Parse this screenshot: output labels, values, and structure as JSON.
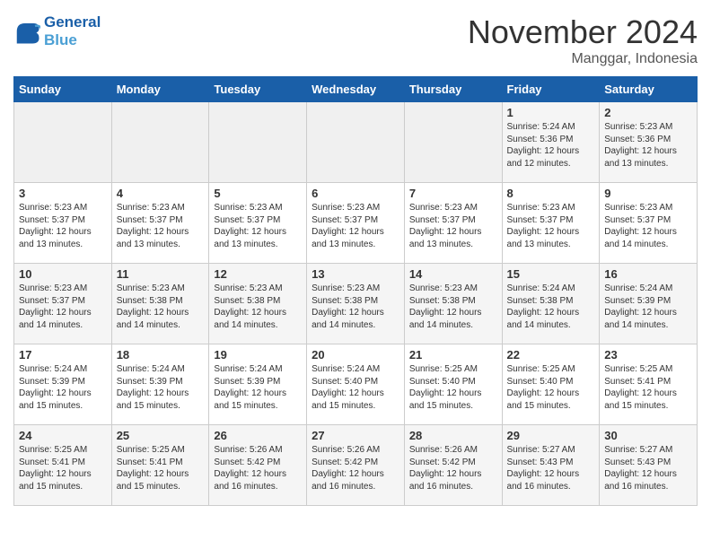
{
  "logo": {
    "text_general": "General",
    "text_blue": "Blue"
  },
  "header": {
    "month": "November 2024",
    "location": "Manggar, Indonesia"
  },
  "days_of_week": [
    "Sunday",
    "Monday",
    "Tuesday",
    "Wednesday",
    "Thursday",
    "Friday",
    "Saturday"
  ],
  "weeks": [
    [
      {
        "day": "",
        "info": ""
      },
      {
        "day": "",
        "info": ""
      },
      {
        "day": "",
        "info": ""
      },
      {
        "day": "",
        "info": ""
      },
      {
        "day": "",
        "info": ""
      },
      {
        "day": "1",
        "info": "Sunrise: 5:24 AM\nSunset: 5:36 PM\nDaylight: 12 hours\nand 12 minutes."
      },
      {
        "day": "2",
        "info": "Sunrise: 5:23 AM\nSunset: 5:36 PM\nDaylight: 12 hours\nand 13 minutes."
      }
    ],
    [
      {
        "day": "3",
        "info": "Sunrise: 5:23 AM\nSunset: 5:37 PM\nDaylight: 12 hours\nand 13 minutes."
      },
      {
        "day": "4",
        "info": "Sunrise: 5:23 AM\nSunset: 5:37 PM\nDaylight: 12 hours\nand 13 minutes."
      },
      {
        "day": "5",
        "info": "Sunrise: 5:23 AM\nSunset: 5:37 PM\nDaylight: 12 hours\nand 13 minutes."
      },
      {
        "day": "6",
        "info": "Sunrise: 5:23 AM\nSunset: 5:37 PM\nDaylight: 12 hours\nand 13 minutes."
      },
      {
        "day": "7",
        "info": "Sunrise: 5:23 AM\nSunset: 5:37 PM\nDaylight: 12 hours\nand 13 minutes."
      },
      {
        "day": "8",
        "info": "Sunrise: 5:23 AM\nSunset: 5:37 PM\nDaylight: 12 hours\nand 13 minutes."
      },
      {
        "day": "9",
        "info": "Sunrise: 5:23 AM\nSunset: 5:37 PM\nDaylight: 12 hours\nand 14 minutes."
      }
    ],
    [
      {
        "day": "10",
        "info": "Sunrise: 5:23 AM\nSunset: 5:37 PM\nDaylight: 12 hours\nand 14 minutes."
      },
      {
        "day": "11",
        "info": "Sunrise: 5:23 AM\nSunset: 5:38 PM\nDaylight: 12 hours\nand 14 minutes."
      },
      {
        "day": "12",
        "info": "Sunrise: 5:23 AM\nSunset: 5:38 PM\nDaylight: 12 hours\nand 14 minutes."
      },
      {
        "day": "13",
        "info": "Sunrise: 5:23 AM\nSunset: 5:38 PM\nDaylight: 12 hours\nand 14 minutes."
      },
      {
        "day": "14",
        "info": "Sunrise: 5:23 AM\nSunset: 5:38 PM\nDaylight: 12 hours\nand 14 minutes."
      },
      {
        "day": "15",
        "info": "Sunrise: 5:24 AM\nSunset: 5:38 PM\nDaylight: 12 hours\nand 14 minutes."
      },
      {
        "day": "16",
        "info": "Sunrise: 5:24 AM\nSunset: 5:39 PM\nDaylight: 12 hours\nand 14 minutes."
      }
    ],
    [
      {
        "day": "17",
        "info": "Sunrise: 5:24 AM\nSunset: 5:39 PM\nDaylight: 12 hours\nand 15 minutes."
      },
      {
        "day": "18",
        "info": "Sunrise: 5:24 AM\nSunset: 5:39 PM\nDaylight: 12 hours\nand 15 minutes."
      },
      {
        "day": "19",
        "info": "Sunrise: 5:24 AM\nSunset: 5:39 PM\nDaylight: 12 hours\nand 15 minutes."
      },
      {
        "day": "20",
        "info": "Sunrise: 5:24 AM\nSunset: 5:40 PM\nDaylight: 12 hours\nand 15 minutes."
      },
      {
        "day": "21",
        "info": "Sunrise: 5:25 AM\nSunset: 5:40 PM\nDaylight: 12 hours\nand 15 minutes."
      },
      {
        "day": "22",
        "info": "Sunrise: 5:25 AM\nSunset: 5:40 PM\nDaylight: 12 hours\nand 15 minutes."
      },
      {
        "day": "23",
        "info": "Sunrise: 5:25 AM\nSunset: 5:41 PM\nDaylight: 12 hours\nand 15 minutes."
      }
    ],
    [
      {
        "day": "24",
        "info": "Sunrise: 5:25 AM\nSunset: 5:41 PM\nDaylight: 12 hours\nand 15 minutes."
      },
      {
        "day": "25",
        "info": "Sunrise: 5:25 AM\nSunset: 5:41 PM\nDaylight: 12 hours\nand 15 minutes."
      },
      {
        "day": "26",
        "info": "Sunrise: 5:26 AM\nSunset: 5:42 PM\nDaylight: 12 hours\nand 16 minutes."
      },
      {
        "day": "27",
        "info": "Sunrise: 5:26 AM\nSunset: 5:42 PM\nDaylight: 12 hours\nand 16 minutes."
      },
      {
        "day": "28",
        "info": "Sunrise: 5:26 AM\nSunset: 5:42 PM\nDaylight: 12 hours\nand 16 minutes."
      },
      {
        "day": "29",
        "info": "Sunrise: 5:27 AM\nSunset: 5:43 PM\nDaylight: 12 hours\nand 16 minutes."
      },
      {
        "day": "30",
        "info": "Sunrise: 5:27 AM\nSunset: 5:43 PM\nDaylight: 12 hours\nand 16 minutes."
      }
    ]
  ]
}
